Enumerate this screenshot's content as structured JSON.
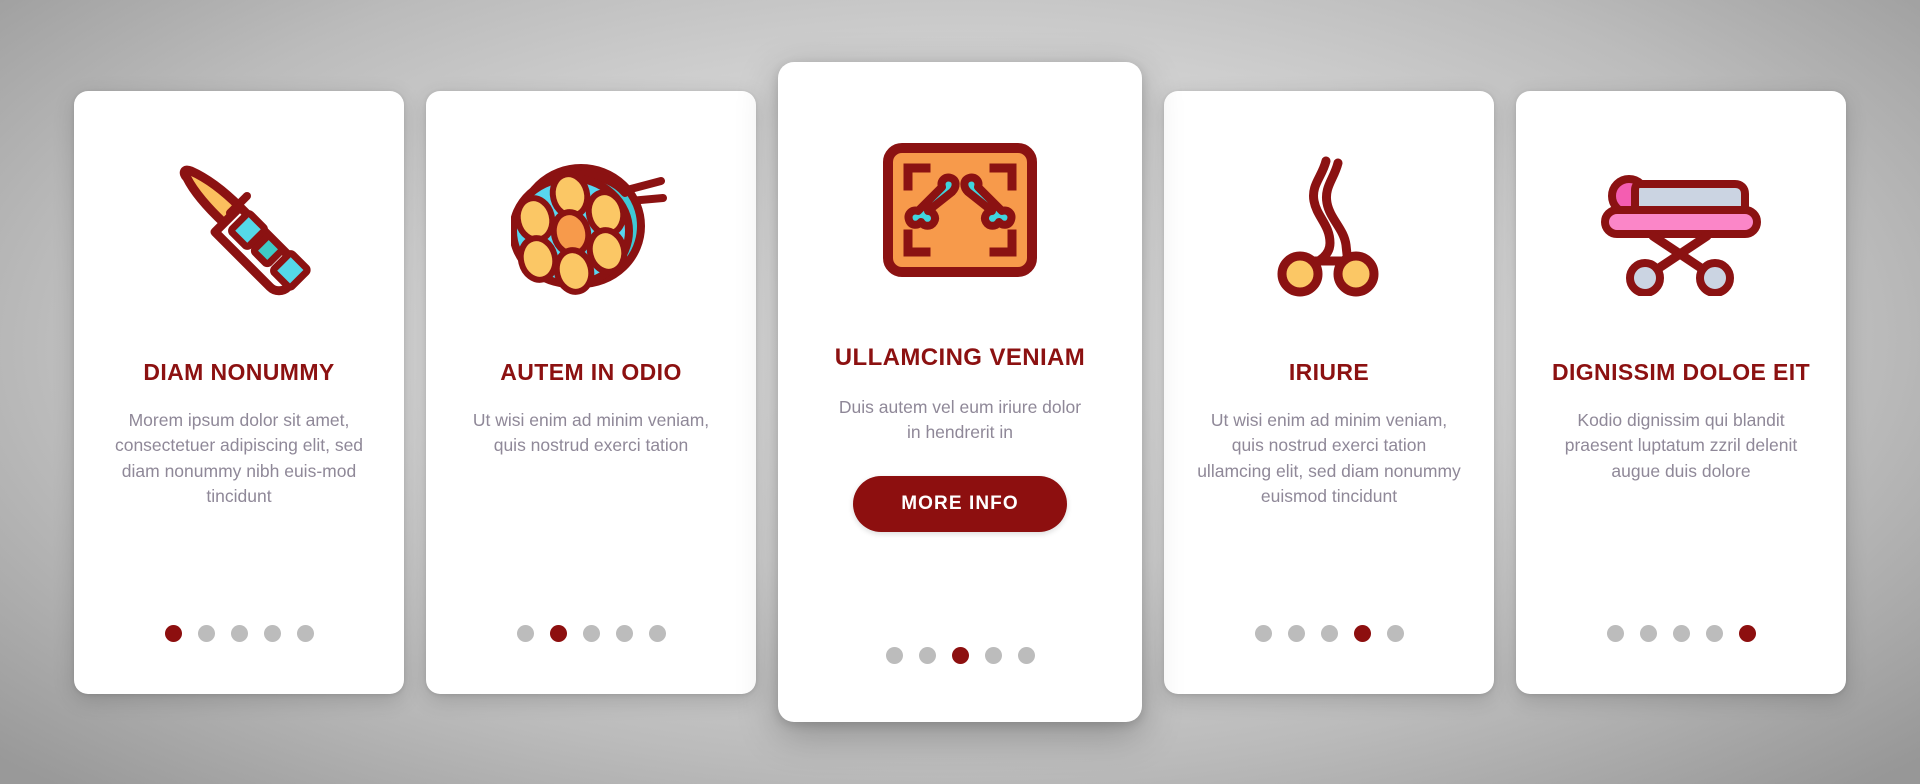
{
  "theme": {
    "accent_red": "#8D0F0F",
    "title_red": "#8C1111",
    "body_gray": "#8F8898",
    "dot_inactive": "#BCBCBC",
    "card_bg": "#FFFFFF",
    "page_bg": "#CFCFCF"
  },
  "cards": [
    {
      "icon": "scalpel-icon",
      "title": "DIAM NONUMMY",
      "description": "Morem ipsum dolor sit amet, consectetuer adipiscing elit, sed diam nonummy nibh euis-mod tincidunt",
      "dots": {
        "count": 5,
        "active": 1
      },
      "featured": false
    },
    {
      "icon": "surgical-lamp-icon",
      "title": "AUTEM IN ODIO",
      "description": "Ut wisi enim ad minim veniam, quis nostrud exerci tation",
      "dots": {
        "count": 5,
        "active": 2
      },
      "featured": false
    },
    {
      "icon": "xray-bones-icon",
      "title": "ULLAMCING VENIAM",
      "description": "Duis autem vel eum iriure dolor in hendrerit in",
      "button_label": "MORE INFO",
      "dots": {
        "count": 5,
        "active": 3
      },
      "featured": true
    },
    {
      "icon": "surgical-forceps-icon",
      "title": "IRIURE",
      "description": "Ut wisi enim ad minim veniam, quis nostrud exerci tation ullamcing elit, sed diam nonummy euismod tincidunt",
      "dots": {
        "count": 5,
        "active": 4
      },
      "featured": false
    },
    {
      "icon": "hospital-stretcher-icon",
      "title": "DIGNISSIM DOLOE EIT",
      "description": "Kodio dignissim qui blandit praesent luptatum zzril delenit augue duis dolore",
      "dots": {
        "count": 5,
        "active": 5
      },
      "featured": false
    }
  ]
}
